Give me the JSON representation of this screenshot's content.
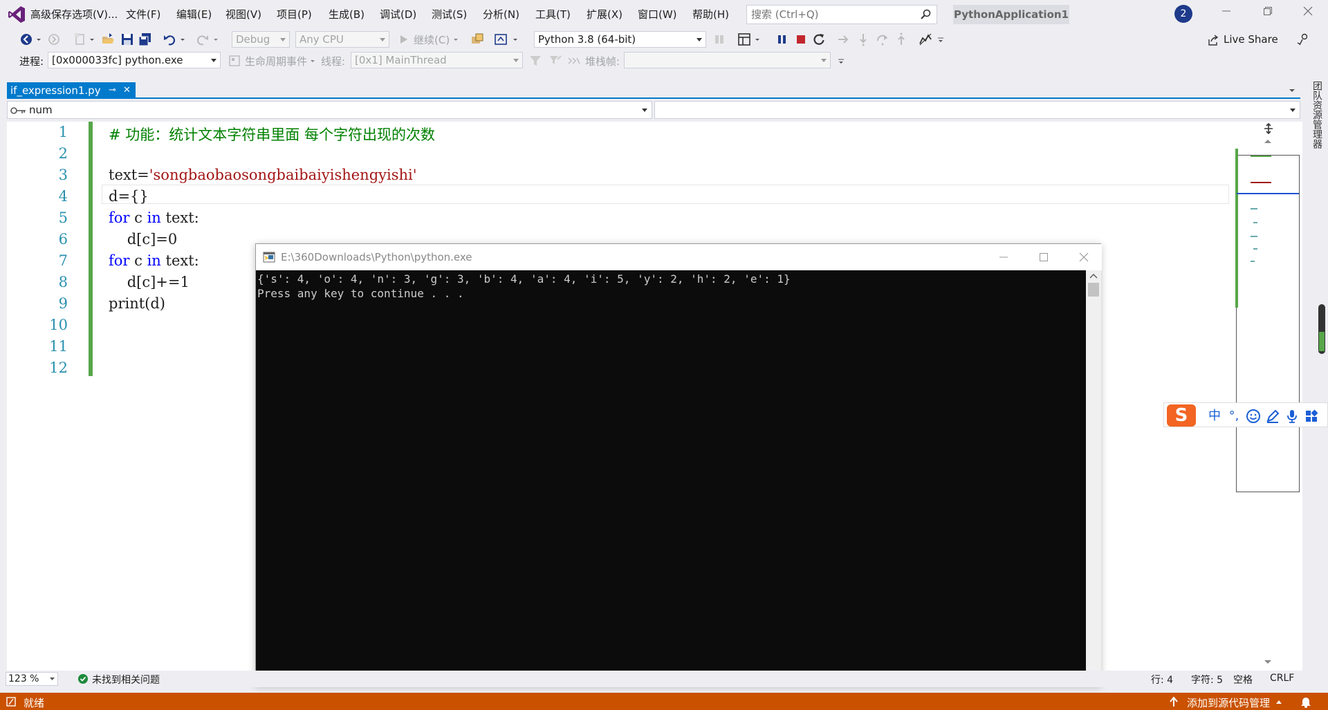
{
  "menu": {
    "items": [
      "高级保存选项(V)...",
      "文件(F)",
      "编辑(E)",
      "视图(V)",
      "项目(P)",
      "生成(B)",
      "调试(D)",
      "测试(S)",
      "分析(N)",
      "工具(T)",
      "扩展(X)",
      "窗口(W)",
      "帮助(H)"
    ],
    "search_placeholder": "搜索 (Ctrl+Q)",
    "solution_name": "PythonApplication1",
    "notification_count": "2"
  },
  "toolbar1": {
    "config": "Debug",
    "platform": "Any CPU",
    "continue_label": "继续(C)",
    "python_env": "Python 3.8 (64-bit)",
    "live_share": "Live Share"
  },
  "toolbar2": {
    "process_label": "进程:",
    "process_value": "[0x000033fc] python.exe",
    "lifecycle_label": "生命周期事件",
    "thread_label": "线程:",
    "thread_value": "[0x1] MainThread",
    "stackframe_label": "堆栈帧:"
  },
  "tab": {
    "filename": "if_expression1.py",
    "pin": "⊸",
    "close": "✕"
  },
  "navbar": {
    "left_value": "num"
  },
  "side_tab": "团队资源管理器",
  "editor": {
    "line_numbers": [
      "1",
      "2",
      "3",
      "4",
      "5",
      "6",
      "7",
      "8",
      "9",
      "10",
      "11",
      "12"
    ],
    "lines": {
      "l1_comment": "# 功能：统计文本字符串里面 每个字符出现的次数",
      "l3_var": "text=",
      "l3_str": "'songbaobaosongbaibaiyishengyishi'",
      "l4": "d={}",
      "l5_kw1": "for",
      "l5_mid": " c ",
      "l5_kw2": "in",
      "l5_end": " text:",
      "l6": "    d[c]=0",
      "l7_kw1": "for",
      "l7_mid": " c ",
      "l7_kw2": "in",
      "l7_end": " text:",
      "l8": "    d[c]+=1",
      "l9": "print(d)"
    }
  },
  "console": {
    "title": "E:\\360Downloads\\Python\\python.exe",
    "output_line1": "{'s': 4, 'o': 4, 'n': 3, 'g': 3, 'b': 4, 'a': 4, 'i': 5, 'y': 2, 'h': 2, 'e': 1}",
    "output_line2": "Press any key to continue . . ."
  },
  "ime": {
    "lang": "中",
    "punct": "°,"
  },
  "editor_status": {
    "zoom": "123 %",
    "issues": "未找到相关问题",
    "line": "行: 4",
    "col": "字符: 5",
    "spacing": "空格",
    "eol": "CRLF"
  },
  "status_bar": {
    "ready": "就绪",
    "source_control": "添加到源代码管理"
  },
  "colors": {
    "accent": "#007acc",
    "status_bar": "#ca5100",
    "change_bar": "#57a64a"
  }
}
